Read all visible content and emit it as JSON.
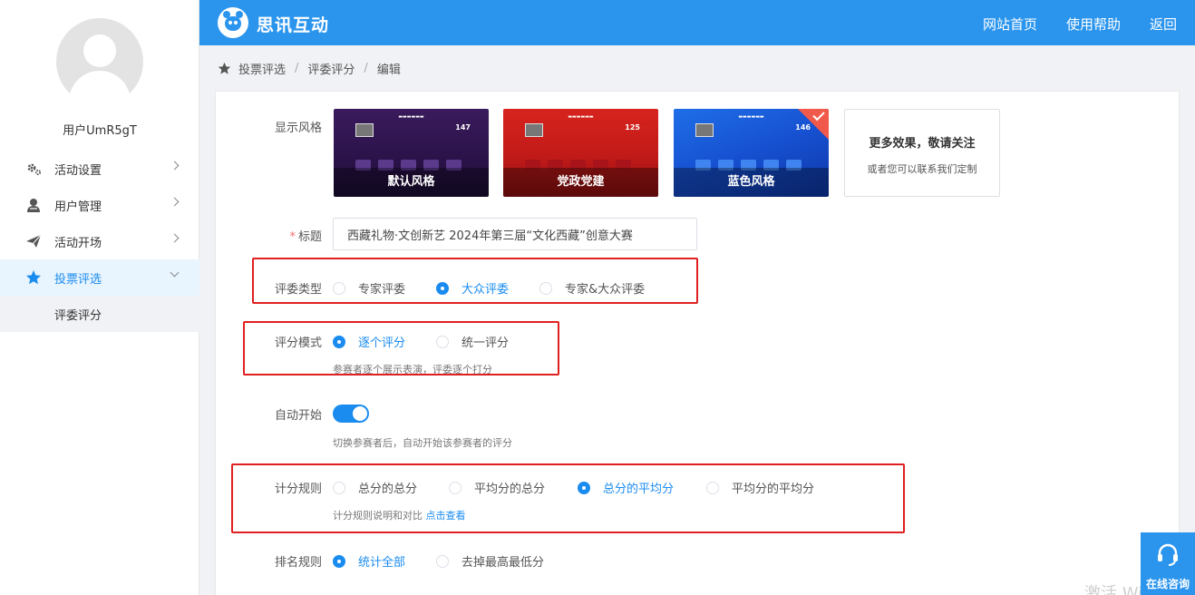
{
  "app": {
    "brand": "思讯互动"
  },
  "header": {
    "links": [
      "网站首页",
      "使用帮助",
      "返回"
    ]
  },
  "user": {
    "name": "用户UmR5gT"
  },
  "sidebar": {
    "items": [
      {
        "label": "活动设置",
        "icon": "gear-icon"
      },
      {
        "label": "用户管理",
        "icon": "user-icon"
      },
      {
        "label": "活动开场",
        "icon": "send-icon"
      },
      {
        "label": "投票评选",
        "icon": "star-icon",
        "active": true
      }
    ],
    "sub_items": [
      {
        "label": "评委评分"
      }
    ]
  },
  "breadcrumb": [
    "投票评选",
    "评委评分",
    "编辑"
  ],
  "form": {
    "style": {
      "label": "显示风格",
      "options": [
        {
          "caption": "默认风格",
          "num": "147"
        },
        {
          "caption": "党政党建",
          "num": "125"
        },
        {
          "caption": "蓝色风格",
          "num": "146",
          "selected": true
        }
      ],
      "more_title": "更多效果，敬请关注",
      "more_sub": "或者您可以联系我们定制"
    },
    "title": {
      "label": "标题",
      "value": "西藏礼物·文创新艺 2024年第三届“文化西藏”创意大赛"
    },
    "judge_type": {
      "label": "评委类型",
      "options": [
        "专家评委",
        "大众评委",
        "专家&大众评委"
      ],
      "selected": "大众评委"
    },
    "score_mode": {
      "label": "评分模式",
      "options": [
        "逐个评分",
        "统一评分"
      ],
      "selected": "逐个评分",
      "hint": "参赛者逐个展示表演，评委逐个打分"
    },
    "auto_start": {
      "label": "自动开始",
      "enabled": true,
      "hint": "切换参赛者后，自动开始该参赛者的评分"
    },
    "score_rule": {
      "label": "计分规则",
      "options": [
        "总分的总分",
        "平均分的总分",
        "总分的平均分",
        "平均分的平均分"
      ],
      "selected": "总分的平均分",
      "hint": "计分规则说明和对比",
      "hint_link": "点击查看"
    },
    "rank_rule": {
      "label": "排名规则",
      "options": [
        "统计全部",
        "去掉最高最低分"
      ],
      "selected": "统计全部"
    }
  },
  "service": {
    "label": "在线咨询"
  },
  "watermark": "激活 Windo",
  "colors": {
    "primary": "#2b95ee",
    "accent": "#1a8cf0",
    "highlight_box": "#e02020"
  }
}
